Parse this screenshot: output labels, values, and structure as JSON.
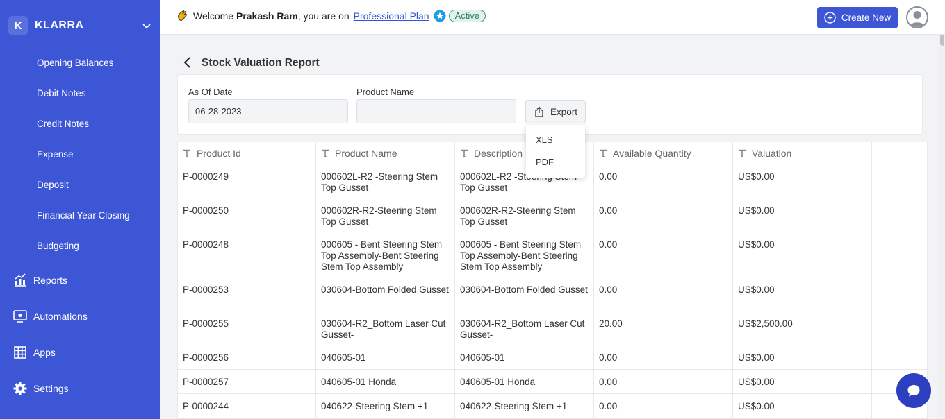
{
  "sidebar": {
    "brand_initial": "K",
    "brand_name": "KLARRA",
    "sub_items": [
      "Opening Balances",
      "Debit Notes",
      "Credit Notes",
      "Expense",
      "Deposit",
      "Financial Year Closing",
      "Budgeting"
    ],
    "main_items": [
      {
        "label": "Reports",
        "icon": "chart-icon"
      },
      {
        "label": "Automations",
        "icon": "automation-icon"
      },
      {
        "label": "Apps",
        "icon": "apps-grid-icon"
      },
      {
        "label": "Settings",
        "icon": "gear-icon"
      }
    ]
  },
  "header": {
    "welcome_prefix": "Welcome",
    "user_name": "Prakash Ram",
    "welcome_suffix": ", you are on",
    "plan_name": "Professional Plan",
    "status": "Active",
    "create_label": "Create New"
  },
  "page": {
    "title": "Stock Valuation Report",
    "as_of_date_label": "As Of Date",
    "as_of_date_value": "06-28-2023",
    "product_name_label": "Product Name",
    "product_name_value": "",
    "export_label": "Export",
    "export_options": [
      "XLS",
      "PDF"
    ]
  },
  "table": {
    "columns": [
      "Product Id",
      "Product Name",
      "Description",
      "Available Quantity",
      "Valuation"
    ],
    "rows": [
      {
        "id": "P-0000249",
        "name": "000602L-R2 -Steering Stem Top Gusset",
        "description": "000602L-R2 -Steering Stem Top Gusset",
        "qty": "0.00",
        "valuation": "US$0.00"
      },
      {
        "id": "P-0000250",
        "name": "000602R-R2-Steering Stem Top Gusset",
        "description": "000602R-R2-Steering Stem Top Gusset",
        "qty": "0.00",
        "valuation": "US$0.00"
      },
      {
        "id": "P-0000248",
        "name": "000605 -  Bent Steering Stem Top Assembly-Bent Steering Stem Top Assembly",
        "description": "000605 -  Bent Steering Stem Top Assembly-Bent Steering Stem Top Assembly",
        "qty": "0.00",
        "valuation": "US$0.00"
      },
      {
        "id": "P-0000253",
        "name": "030604-Bottom Folded Gusset",
        "description": "030604-Bottom Folded Gusset",
        "qty": "0.00",
        "valuation": "US$0.00"
      },
      {
        "id": "P-0000255",
        "name": "030604-R2_Bottom Laser Cut Gusset-",
        "description": "030604-R2_Bottom Laser Cut Gusset-",
        "qty": "20.00",
        "valuation": "US$2,500.00"
      },
      {
        "id": "P-0000256",
        "name": "040605-01",
        "description": "040605-01",
        "qty": "0.00",
        "valuation": "US$0.00"
      },
      {
        "id": "P-0000257",
        "name": "040605-01 Honda",
        "description": "040605-01 Honda",
        "qty": "0.00",
        "valuation": "US$0.00"
      },
      {
        "id": "P-0000244",
        "name": "040622-Steering Stem +1",
        "description": "040622-Steering Stem +1",
        "qty": "0.00",
        "valuation": "US$0.00"
      }
    ]
  },
  "colors": {
    "sidebar": "#3d56d6",
    "primary": "#3d56d6",
    "active_badge": "#2f9b72",
    "link": "#2b55d6"
  }
}
